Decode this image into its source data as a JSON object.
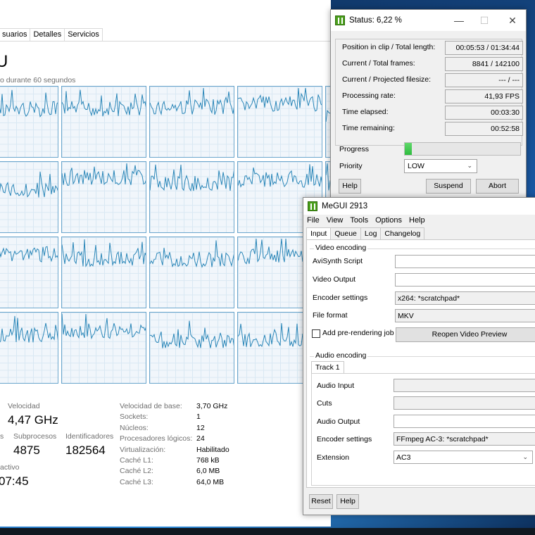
{
  "taskmgr": {
    "tabs": [
      "suarios",
      "Detalles",
      "Servicios"
    ],
    "cpu_title": "U",
    "graph_caption": "o durante 60 segundos",
    "stats": {
      "velocidad_label": "Velocidad",
      "velocidad_value": "4,47 GHz",
      "subprocesos_label": "Subprocesos",
      "subprocesos_value": "4875",
      "identificadores_label": "Identificadores",
      "identificadores_value": "182564",
      "left_label_1": "s",
      "activo_label": "activo",
      "activo_value": "07:45"
    },
    "specs": [
      {
        "label": "Velocidad de base:",
        "value": "3,70 GHz"
      },
      {
        "label": "Sockets:",
        "value": "1"
      },
      {
        "label": "Núcleos:",
        "value": "12"
      },
      {
        "label": "Procesadores lógicos:",
        "value": "24"
      },
      {
        "label": "Virtualización:",
        "value": "Habilitado"
      },
      {
        "label": "Caché L1:",
        "value": "768 kB"
      },
      {
        "label": "Caché L2:",
        "value": "6,0 MB"
      },
      {
        "label": "Caché L3:",
        "value": "64,0 MB"
      }
    ],
    "graph_color": "#2a86b8"
  },
  "status": {
    "title": "Status: 6,22 %",
    "rows": [
      {
        "label": "Position in clip / Total length:",
        "value": "00:05:53 / 01:34:44"
      },
      {
        "label": "Current / Total frames:",
        "value": "8841 / 142100"
      },
      {
        "label": "Current / Projected filesize:",
        "value": "--- / ---"
      },
      {
        "label": "Processing rate:",
        "value": "41,93 FPS"
      },
      {
        "label": "Time elapsed:",
        "value": "00:03:30"
      },
      {
        "label": "Time remaining:",
        "value": "00:52:58"
      }
    ],
    "progress_label": "Progress",
    "progress_percent": 6.22,
    "priority_label": "Priority",
    "priority_value": "LOW",
    "help_label": "Help",
    "suspend_label": "Suspend",
    "abort_label": "Abort",
    "minimize_glyph": "—",
    "maximize_glyph": "☐",
    "close_glyph": "✕"
  },
  "megui": {
    "title": "MeGUI 2913",
    "menu": [
      "File",
      "View",
      "Tools",
      "Options",
      "Help"
    ],
    "tabs": [
      "Input",
      "Queue",
      "Log",
      "Changelog"
    ],
    "video_group": "Video encoding",
    "avisynth_label": "AviSynth Script",
    "avisynth_value": "",
    "video_output_label": "Video Output",
    "video_output_value": "",
    "encoder_label": "Encoder settings",
    "encoder_value": "x264: *scratchpad*",
    "file_format_label": "File format",
    "file_format_value": "MKV",
    "prerender_label": "Add pre-rendering job",
    "reopen_label": "Reopen Video Preview",
    "audio_group": "Audio encoding",
    "track_tab": "Track 1",
    "audio_input_label": "Audio Input",
    "audio_input_value": "",
    "cuts_label": "Cuts",
    "cuts_value": "",
    "audio_output_label": "Audio Output",
    "audio_output_value": "",
    "audio_encoder_label": "Encoder settings",
    "audio_encoder_value": "FFmpeg AC-3: *scratchpad*",
    "extension_label": "Extension",
    "extension_value": "AC3",
    "reset_label": "Reset",
    "help_label": "Help"
  }
}
